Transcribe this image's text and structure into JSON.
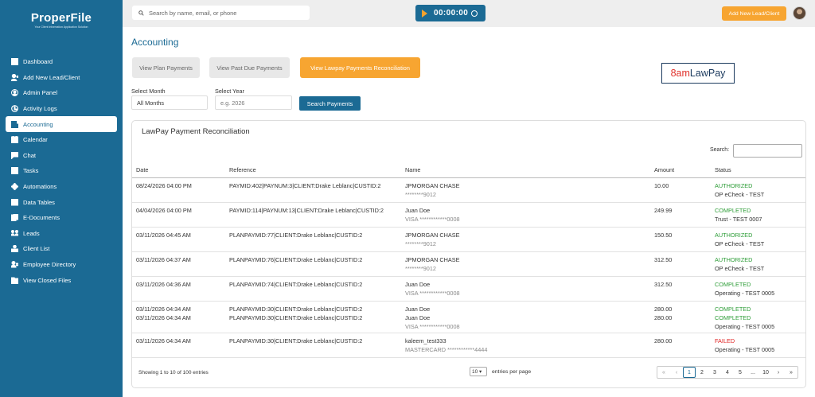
{
  "brand": {
    "name": "ProperFile",
    "tagline": "Your Client Information Application Solution"
  },
  "sidebar": {
    "items": [
      {
        "label": "Dashboard",
        "icon": "dashboard-icon",
        "active": false
      },
      {
        "label": "Add New Lead/Client",
        "icon": "add-user-icon",
        "active": false
      },
      {
        "label": "Admin Panel",
        "icon": "admin-icon",
        "active": false
      },
      {
        "label": "Activity Logs",
        "icon": "clock-icon",
        "active": false
      },
      {
        "label": "Accounting",
        "icon": "accounting-icon",
        "active": true
      },
      {
        "label": "Calendar",
        "icon": "calendar-icon",
        "active": false
      },
      {
        "label": "Chat",
        "icon": "chat-icon",
        "active": false
      },
      {
        "label": "Tasks",
        "icon": "tasks-icon",
        "active": false
      },
      {
        "label": "Automations",
        "icon": "automations-icon",
        "active": false
      },
      {
        "label": "Data Tables",
        "icon": "table-icon",
        "active": false
      },
      {
        "label": "E-Documents",
        "icon": "documents-icon",
        "active": false
      },
      {
        "label": "Leads",
        "icon": "leads-icon",
        "active": false
      },
      {
        "label": "Client List",
        "icon": "client-list-icon",
        "active": false
      },
      {
        "label": "Employee Directory",
        "icon": "directory-icon",
        "active": false
      },
      {
        "label": "View Closed Files",
        "icon": "folder-icon",
        "active": false
      }
    ]
  },
  "topbar": {
    "search_placeholder": "Search by name, email, or phone",
    "timer": "00:00:00",
    "add_lead_label": "Add New Lead/Client"
  },
  "page": {
    "title": "Accounting",
    "tabs": [
      {
        "label": "View Plan Payments"
      },
      {
        "label": "View Past Due Payments"
      },
      {
        "label": "View Lawpay Payments Reconciliation"
      }
    ],
    "lawpay_logo": {
      "first": "8am",
      "second": "LawPay"
    },
    "filters": {
      "month_label": "Select Month",
      "month_value": "All Months",
      "year_label": "Select Year",
      "year_placeholder": "e.g. 2026",
      "search_button": "Search Payments"
    }
  },
  "recon": {
    "title": "LawPay Payment Reconciliation",
    "search_label": "Search:",
    "columns": [
      "Date",
      "Reference",
      "Name",
      "Amount",
      "Status"
    ],
    "rows": [
      {
        "date": "08/24/2026 04:00 PM",
        "reference": "PAYMID:402|PAYNUM:3|CLIENT:Drake Leblanc|CUSTID:2",
        "name": "JPMORGAN CHASE",
        "account": "********9012",
        "amount": "10.00",
        "status": "AUTHORIZED",
        "status_type": "auth",
        "account_label": "OP eCheck - TEST"
      },
      {
        "date": "04/04/2026 04:00 PM",
        "reference": "PAYMID:114|PAYNUM:13|CLIENT:Drake Leblanc|CUSTID:2",
        "name": "Juan Doe",
        "account": "VISA ************0008",
        "amount": "249.99",
        "status": "COMPLETED",
        "status_type": "comp",
        "account_label": "Trust - TEST 0007"
      },
      {
        "date": "03/11/2026 04:45 AM",
        "reference": "PLANPAYMID:77|CLIENT:Drake Leblanc|CUSTID:2",
        "name": "JPMORGAN CHASE",
        "account": "********9012",
        "amount": "150.50",
        "status": "AUTHORIZED",
        "status_type": "auth",
        "account_label": "OP eCheck - TEST"
      },
      {
        "date": "03/11/2026 04:37 AM",
        "reference": "PLANPAYMID:76|CLIENT:Drake Leblanc|CUSTID:2",
        "name": "JPMORGAN CHASE",
        "account": "********9012",
        "amount": "312.50",
        "status": "AUTHORIZED",
        "status_type": "auth",
        "account_label": "OP eCheck - TEST"
      },
      {
        "date": "03/11/2026 04:36 AM",
        "reference": "PLANPAYMID:74|CLIENT:Drake Leblanc|CUSTID:2",
        "name": "Juan Doe",
        "account": "VISA ************0008",
        "amount": "312.50",
        "status": "COMPLETED",
        "status_type": "comp",
        "account_label": "Operating - TEST 0005"
      }
    ],
    "double_row": {
      "date1": "03/11/2026 04:34 AM",
      "date2": "03/11/2026 04:34 AM",
      "reference1": "PLANPAYMID:30|CLIENT:Drake Leblanc|CUSTID:2",
      "reference2": "PLANPAYMID:30|CLIENT:Drake Leblanc|CUSTID:2",
      "name1": "Juan Doe",
      "name2": "Juan Doe",
      "account": "VISA ************0008",
      "amount1": "280.00",
      "amount2": "280.00",
      "status1": "COMPLETED",
      "status2": "COMPLETED",
      "account_label": "Operating - TEST 0005"
    },
    "last_row": {
      "date": "03/11/2026 04:34 AM",
      "reference": "PLANPAYMID:30|CLIENT:Drake Leblanc|CUSTID:2",
      "name": "kaleem_test333",
      "account": "MASTERCARD ************4444",
      "amount": "280.00",
      "status": "FAILED",
      "account_label": "Operating - TEST 0005"
    },
    "footer": {
      "info": "Showing 1 to 10 of 100 entries",
      "page_size": "10",
      "page_size_suffix": "entries per page",
      "pager": [
        "«",
        "‹",
        "1",
        "2",
        "3",
        "4",
        "5",
        "...",
        "10",
        "›",
        "»"
      ]
    }
  },
  "colors": {
    "primary": "#1b6a94",
    "accent": "#f7a531",
    "success": "#2e9d38",
    "danger": "#e02424"
  }
}
